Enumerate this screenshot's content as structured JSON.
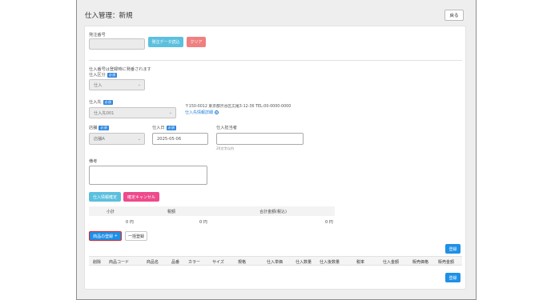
{
  "page": {
    "title": "仕入管理：新規",
    "back_label": "戻る"
  },
  "order": {
    "label": "発注番号",
    "value": "",
    "load_label": "発注データ読込",
    "clear_label": "クリア"
  },
  "purchase_type": {
    "note": "仕入番号は登録時に発番されます",
    "label": "仕入区分",
    "required": "必須",
    "value": "仕入"
  },
  "supplier": {
    "label": "仕入先",
    "required": "必須",
    "value": "仕入先001",
    "address": "〒150-0012 東京都渋谷区広尾3-12-36 TEL:00-0000-0000",
    "detail_link": "仕入先情報詳細",
    "detail_icon": "plus-circle-icon"
  },
  "store": {
    "label": "店舗",
    "required": "必須",
    "value": "店舗A"
  },
  "purchase_date": {
    "label": "仕入日",
    "required": "必須",
    "value": "2025-05-06"
  },
  "staff": {
    "label": "仕入担当者",
    "value": "",
    "hint": "20文字以内"
  },
  "remarks": {
    "label": "備考",
    "value": ""
  },
  "info_buttons": {
    "confirm_label": "仕入情報確定",
    "cancel_label": "確定キャンセル"
  },
  "totals": {
    "headers": [
      "小計",
      "税額",
      "合計金額(税込)"
    ],
    "values": [
      "0 円",
      "0 円",
      "0 円"
    ]
  },
  "product_buttons": {
    "register_label": "商品の登録",
    "register_icon": "plus-icon",
    "bulk_label": "一括登録"
  },
  "save_label": "登録",
  "items_table": {
    "headers": [
      "削除",
      "商品コード",
      "商品名",
      "品番",
      "カラー",
      "サイズ",
      "規格",
      "仕入単価",
      "仕入数量",
      "仕入後数量",
      "税率",
      "仕入金額",
      "販売価格",
      "販売金額"
    ]
  },
  "colors": {
    "teal": "#5bc0de",
    "pink": "#f08080",
    "magenta": "#ee4a8c",
    "blue": "#1e90e6",
    "required_badge": "#2e86de",
    "highlight": "#e02020"
  }
}
